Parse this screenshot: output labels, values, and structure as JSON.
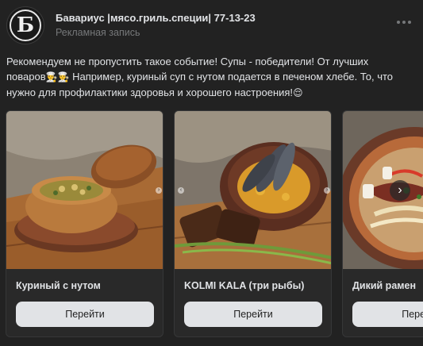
{
  "header": {
    "author": "Бавариус |мясо.гриль.специи| 77-13-23",
    "ad_label": "Рекламная запись",
    "avatar_letter": "Б"
  },
  "post_text": {
    "line1": "Рекомендуем не пропустить такое событие! Супы - победители! От лучших",
    "line2_start": "поваров",
    "line2_emoji": "👨‍🍳👨‍🍳",
    "line2_rest": " Например, куриный суп с нутом подается в печеном хлебе. То, что",
    "line3": "нужно для профилактики здоровья и хорошего настроения!",
    "line3_emoji": "😌"
  },
  "carousel": {
    "cards": [
      {
        "title": "Куриный с нутом",
        "button": "Перейти",
        "icon": "chicken-soup-bread-image"
      },
      {
        "title": "KOLMI KALA (три рыбы)",
        "button": "Перейти",
        "icon": "fish-soup-image"
      },
      {
        "title": "Дикий рамен",
        "button": "Перейти",
        "icon": "ramen-image"
      }
    ],
    "next_icon": "›",
    "prev_icon": "‹"
  },
  "colors": {
    "background": "#222222",
    "card": "#292929",
    "button": "#e1e3e6",
    "muted": "#76787a"
  }
}
